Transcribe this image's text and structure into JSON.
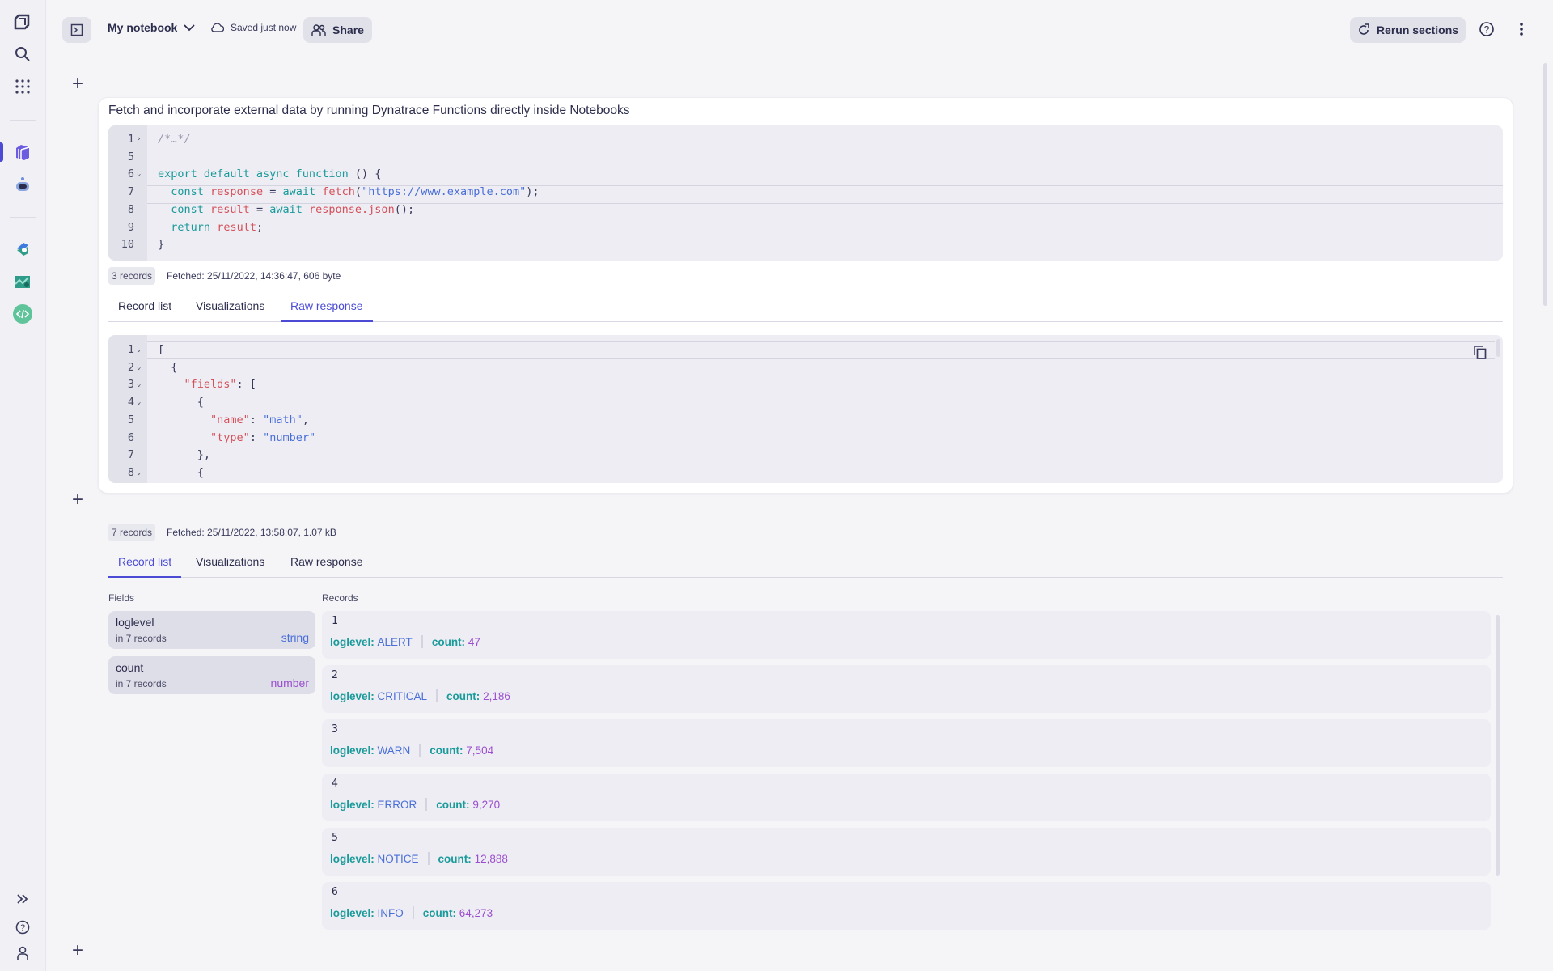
{
  "sidebar": {
    "top_icons": [
      "dynatrace-logo-icon",
      "search-icon",
      "apps-grid-icon"
    ],
    "app_icons": [
      "notebooks-icon",
      "davis-assistant-icon"
    ],
    "pinned_icons": [
      "workflows-icon",
      "dashboards-icon",
      "functions-icon"
    ],
    "bottom_icons": [
      "expand-icon",
      "help-icon",
      "user-icon"
    ],
    "accent": "#4b4bd6"
  },
  "header": {
    "notebook_title": "My notebook",
    "save_status": "Saved just now",
    "share_label": "Share",
    "rerun_label": "Rerun sections"
  },
  "section1": {
    "title": "Fetch and incorporate external data by running Dynatrace Functions directly inside Notebooks",
    "code_lines": [
      {
        "n": "1",
        "fold": "›",
        "html": "<span class='cm'>/*…*/</span>"
      },
      {
        "n": "5",
        "fold": "",
        "html": ""
      },
      {
        "n": "6",
        "fold": "⌄",
        "html": "<span class='kw'>export default async function</span> <span class='pl'>() {</span>"
      },
      {
        "n": "7",
        "fold": "",
        "html": "  <span class='kw'>const</span> <span class='var'>response</span> <span class='pl'>=</span> <span class='kw'>await</span> <span class='var'>fetch</span><span class='pl'>(</span><span class='str'>\"https://www.example.com\"</span><span class='pl'>);</span>"
      },
      {
        "n": "8",
        "fold": "",
        "html": "  <span class='kw'>const</span> <span class='var'>result</span> <span class='pl'>=</span> <span class='kw'>await</span> <span class='var'>response.json</span><span class='pl'>();</span>"
      },
      {
        "n": "9",
        "fold": "",
        "html": "  <span class='kw'>return</span> <span class='var'>result</span><span class='pl'>;</span>"
      },
      {
        "n": "10",
        "fold": "",
        "html": "<span class='pl'>}</span>"
      }
    ],
    "records_badge": "3 records",
    "fetched": "Fetched: 25/11/2022, 14:36:47, 606 byte",
    "tabs": [
      "Record list",
      "Visualizations",
      "Raw response"
    ],
    "active_tab": "Raw response",
    "raw_lines": [
      {
        "n": "1",
        "fold": "⌄",
        "html": "<span class='pl'>[</span>"
      },
      {
        "n": "2",
        "fold": "⌄",
        "html": "  <span class='pl'>{</span>"
      },
      {
        "n": "3",
        "fold": "⌄",
        "html": "    <span class='var'>\"fields\"</span><span class='pl'>: [</span>"
      },
      {
        "n": "4",
        "fold": "⌄",
        "html": "      <span class='pl'>{</span>"
      },
      {
        "n": "5",
        "fold": "",
        "html": "        <span class='var'>\"name\"</span><span class='pl'>: </span><span class='str'>\"math\"</span><span class='pl'>,</span>"
      },
      {
        "n": "6",
        "fold": "",
        "html": "        <span class='var'>\"type\"</span><span class='pl'>: </span><span class='str'>\"number\"</span>"
      },
      {
        "n": "7",
        "fold": "",
        "html": "      <span class='pl'>},</span>"
      },
      {
        "n": "8",
        "fold": "⌄",
        "html": "      <span class='pl'>{</span>"
      }
    ]
  },
  "section2": {
    "records_badge": "7 records",
    "fetched": "Fetched: 25/11/2022, 13:58:07, 1.07 kB",
    "tabs": [
      "Record list",
      "Visualizations",
      "Raw response"
    ],
    "active_tab": "Record list",
    "fields_label": "Fields",
    "records_label": "Records",
    "fields": [
      {
        "name": "loglevel",
        "count": "in 7 records",
        "type": "string",
        "type_color": "#4a6fd8"
      },
      {
        "name": "count",
        "count": "in 7 records",
        "type": "number",
        "type_color": "#9b4fcf"
      }
    ],
    "records": [
      {
        "index": "1",
        "loglevel": "ALERT",
        "count": "47"
      },
      {
        "index": "2",
        "loglevel": "CRITICAL",
        "count": "2,186"
      },
      {
        "index": "3",
        "loglevel": "WARN",
        "count": "7,504"
      },
      {
        "index": "4",
        "loglevel": "ERROR",
        "count": "9,270"
      },
      {
        "index": "5",
        "loglevel": "NOTICE",
        "count": "12,888"
      },
      {
        "index": "6",
        "loglevel": "INFO",
        "count": "64,273"
      }
    ],
    "key_loglevel": "loglevel:",
    "key_count": "count:"
  }
}
